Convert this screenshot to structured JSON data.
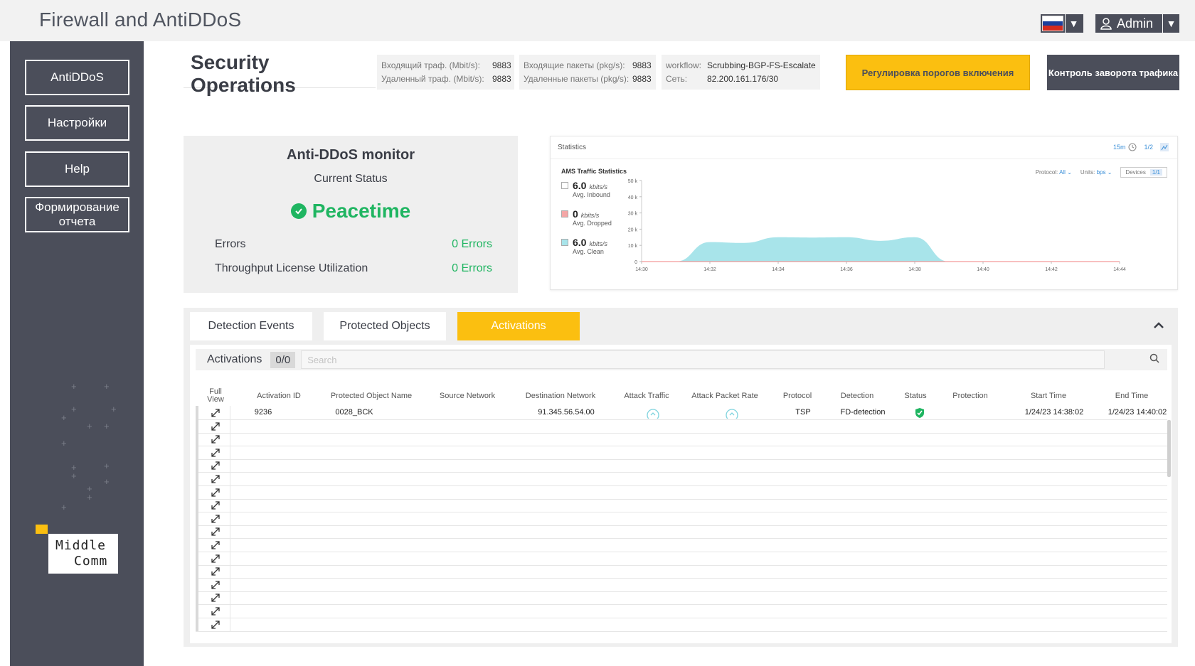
{
  "app": {
    "title": "Firewall and AntiDDoS"
  },
  "header": {
    "user_label": "Admin",
    "flag_colors": [
      "#ffffff",
      "#1c3f9c",
      "#d52b1e"
    ]
  },
  "sidebar": {
    "items": [
      {
        "label": "AntiDDoS"
      },
      {
        "label": "Настройки"
      },
      {
        "label": "Help"
      },
      {
        "label": "Формирование отчета"
      }
    ],
    "logo": {
      "line1": "Middle",
      "line2": "Comm"
    }
  },
  "secops": {
    "title": "Security Operations",
    "card1": {
      "in_label": "Входящий траф. (Mbit/s):",
      "in_value": "9883",
      "out_label": "Удаленный траф. (Mbit/s):",
      "out_value": "9883"
    },
    "card2": {
      "in_label": "Входящие пакеты (pkg/s):",
      "in_value": "9883",
      "out_label": "Удаленные пакеты (pkg/s):",
      "out_value": "9883"
    },
    "card3": {
      "workflow_label": "workflow:",
      "workflow_value": "Scrubbing-BGP-FS-Escalate",
      "net_label": "Сеть:",
      "net_value": "82.200.161.176/30"
    },
    "btn_thresholds": "Регулировка порогов включения",
    "btn_redirect": "Контроль заворота трафика"
  },
  "monitor": {
    "title": "Anti-DDoS monitor",
    "subtitle": "Current Status",
    "status": "Peacetime",
    "rows": [
      {
        "label": "Errors",
        "value": "0 Errors"
      },
      {
        "label": "Throughput License Utilization",
        "value": "0 Errors"
      }
    ]
  },
  "statistics": {
    "title": "Statistics",
    "period": "15m",
    "page": "1/2",
    "ams_title": "AMS Traffic Statistics",
    "protocol_label": "Protocol:",
    "protocol_value": "All",
    "units_label": "Units:",
    "units_value": "bps",
    "devices_label": "Devices",
    "devices_value": "1/1",
    "legend": [
      {
        "value": "6.0",
        "unit": "kbits/s",
        "label": "Avg. Inbound",
        "color": "#ffffff"
      },
      {
        "value": "0",
        "unit": "kbits/s",
        "label": "Avg. Dropped",
        "color": "#f4a6a6"
      },
      {
        "value": "6.0",
        "unit": "kbits/s",
        "label": "Avg. Clean",
        "color": "#a8e4ea"
      }
    ]
  },
  "chart_data": {
    "type": "area",
    "title": "AMS Traffic Statistics",
    "x": [
      "14:30",
      "14:31",
      "14:32",
      "14:33",
      "14:34",
      "14:35",
      "14:36",
      "14:37",
      "14:38",
      "14:39",
      "14:40",
      "14:41",
      "14:42",
      "14:43",
      "14:44"
    ],
    "xticks": [
      "14:30",
      "14:32",
      "14:34",
      "14:36",
      "14:38",
      "14:40",
      "14:42",
      "14:44"
    ],
    "yticks": [
      "0",
      "10 k",
      "20 k",
      "30 k",
      "40 k",
      "50 k"
    ],
    "ylim": [
      0,
      50000
    ],
    "series": [
      {
        "values": [
          0,
          0,
          12000,
          11500,
          15000,
          14800,
          15000,
          12800,
          15000,
          0,
          0,
          0,
          0,
          0,
          0
        ],
        "color": "#a8e4ea"
      }
    ],
    "grid": false
  },
  "tabs": [
    {
      "label": "Detection Events",
      "active": false
    },
    {
      "label": "Protected  Objects",
      "active": false
    },
    {
      "label": "Activations",
      "active": true
    }
  ],
  "activations": {
    "label": "Activations",
    "count": "0/0",
    "search_placeholder": "Search",
    "columns": [
      "Full View",
      "Activation ID",
      "Protected Object Name",
      "Source Network",
      "Destination Network",
      "Attack Traffic",
      "Attack Packet Rate",
      "Protocol",
      "Detection",
      "Status",
      "Protection",
      "Start Time",
      "End Time"
    ],
    "rows": [
      {
        "activation_id": "9236",
        "object_name": "0028_BCK",
        "source_network": "",
        "destination_network": "91.345.56.54.00",
        "protocol": "TSP",
        "detection": "FD-detection",
        "start_time": "1/24/23 14:38:02",
        "end_time": "1/24/23 14:40:02"
      }
    ],
    "empty_rows": 16
  }
}
